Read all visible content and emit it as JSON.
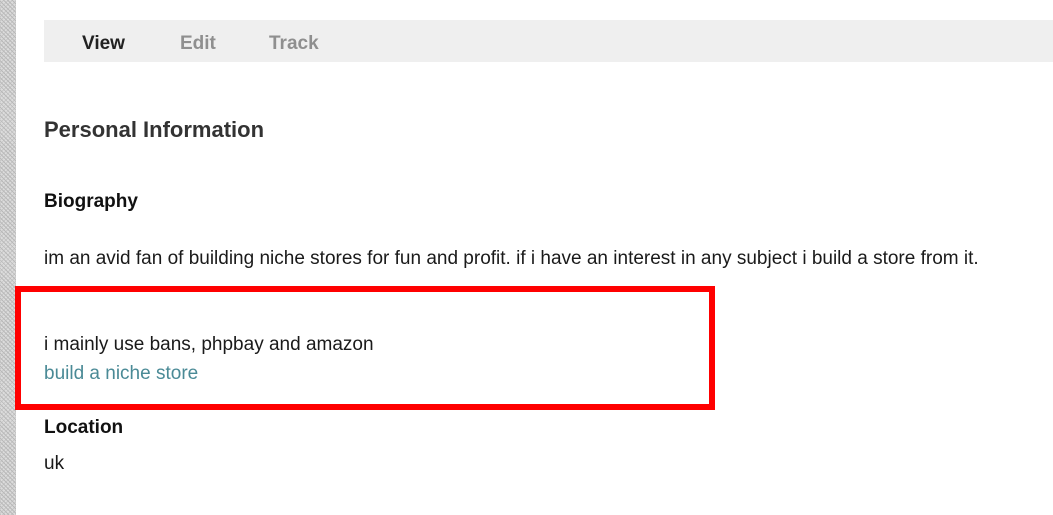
{
  "tabs": [
    {
      "label": "View",
      "active": true
    },
    {
      "label": "Edit",
      "active": false
    },
    {
      "label": "Track",
      "active": false
    }
  ],
  "page_title": "Personal Information",
  "biography": {
    "title": "Biography",
    "paragraph1": "im an avid fan of building niche stores for fun and profit. if i have an interest in any subject i build a store from it.",
    "paragraph2": "i mainly use bans, phpbay and amazon",
    "link_text": "build a niche store"
  },
  "location": {
    "title": "Location",
    "value": "uk"
  },
  "colors": {
    "tab_bar": "#efefef",
    "tab_active": "#222222",
    "tab_inactive": "#8f8f8f",
    "link": "#4a8a96",
    "highlight": "#ff0000"
  }
}
